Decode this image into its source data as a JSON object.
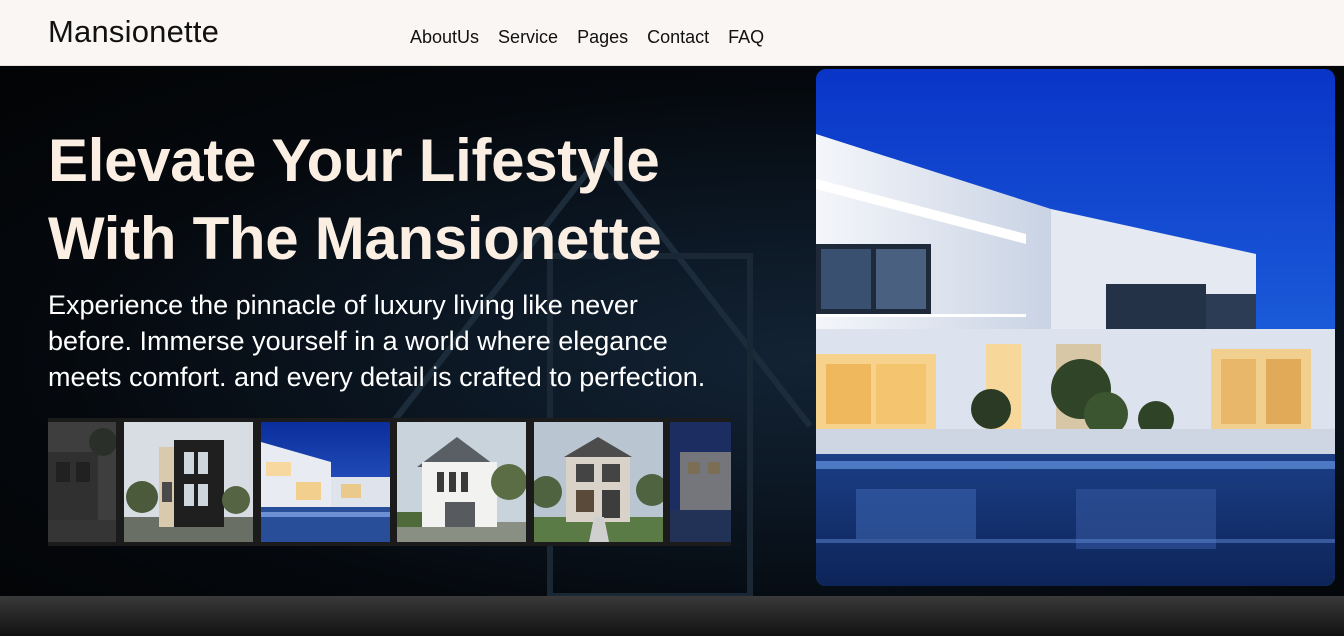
{
  "navbar": {
    "logo": "Mansionette",
    "links": [
      "AboutUs",
      "Service",
      "Pages",
      "Contact",
      "FAQ"
    ]
  },
  "hero": {
    "headline_line1": "Elevate Your Lifestyle",
    "headline_line2": "With The Mansionette",
    "subtext_line1": "Experience the pinnacle of luxury living like never",
    "subtext_line2": "before. Immerse yourself in a world where elegance",
    "subtext_line3": "meets comfort. and every detail is crafted to perfection."
  },
  "colors": {
    "headline": "#fbefe4",
    "navbar_bg": "#faf6f4",
    "hero_bg": "#0b1622"
  },
  "thumbnails": [
    "house-photo-1",
    "house-photo-2",
    "house-photo-3",
    "house-photo-4",
    "house-photo-5",
    "house-photo-6"
  ]
}
